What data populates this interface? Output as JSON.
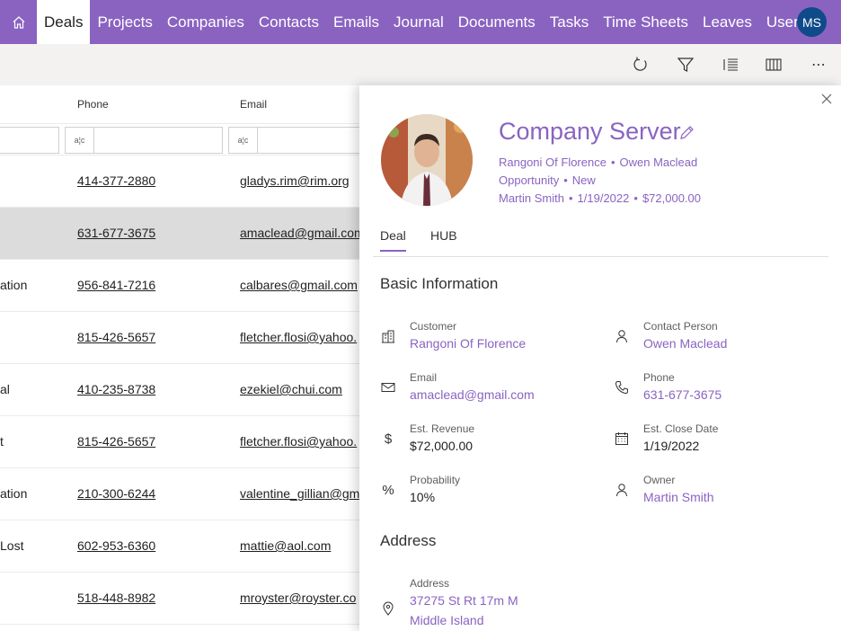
{
  "nav": {
    "items": [
      "Deals",
      "Projects",
      "Companies",
      "Contacts",
      "Emails",
      "Journal",
      "Documents",
      "Tasks",
      "Time Sheets",
      "Leaves",
      "Users"
    ],
    "active": "Deals",
    "user_initials": "MS"
  },
  "toolbar": {
    "icons": [
      "refresh-icon",
      "filter-icon",
      "list-view-icon",
      "columns-icon",
      "more-icon"
    ],
    "more_label": "⋯"
  },
  "grid": {
    "headers": {
      "phone": "Phone",
      "email": "Email"
    },
    "filter_icon_text": "a¦c",
    "rows": [
      {
        "stage": "",
        "phone": "414-377-2880",
        "email": "gladys.rim@rim.org"
      },
      {
        "stage": "",
        "phone": "631-677-3675",
        "email": "amaclead@gmail.com",
        "selected": true
      },
      {
        "stage": "ation",
        "phone": "956-841-7216",
        "email": "calbares@gmail.com"
      },
      {
        "stage": "",
        "phone": "815-426-5657",
        "email": "fletcher.flosi@yahoo."
      },
      {
        "stage": "al",
        "phone": "410-235-8738",
        "email": "ezekiel@chui.com"
      },
      {
        "stage": "t",
        "phone": "815-426-5657",
        "email": "fletcher.flosi@yahoo."
      },
      {
        "stage": "ation",
        "phone": "210-300-6244",
        "email": "valentine_gillian@gm"
      },
      {
        "stage": "Lost",
        "phone": "602-953-6360",
        "email": "mattie@aol.com"
      },
      {
        "stage": "",
        "phone": "518-448-8982",
        "email": "mroyster@royster.co"
      }
    ]
  },
  "panel": {
    "title": "Company Server",
    "meta_line1": {
      "company": "Rangoni Of Florence",
      "contact": "Owen Maclead"
    },
    "meta_line2": {
      "type": "Opportunity",
      "stage": "New"
    },
    "meta_line3": {
      "owner": "Martin Smith",
      "date": "1/19/2022",
      "amount": "$72,000.00"
    },
    "dot": "•",
    "tabs": [
      "Deal",
      "HUB"
    ],
    "basic_title": "Basic Information",
    "fields": {
      "customer": {
        "label": "Customer",
        "value": "Rangoni Of Florence"
      },
      "contact_person": {
        "label": "Contact Person",
        "value": "Owen Maclead"
      },
      "email": {
        "label": "Email",
        "value": "amaclead@gmail.com"
      },
      "phone": {
        "label": "Phone",
        "value": "631-677-3675"
      },
      "revenue": {
        "label": "Est. Revenue",
        "value": "$72,000.00"
      },
      "close_date": {
        "label": "Est. Close Date",
        "value": "1/19/2022"
      },
      "probability": {
        "label": "Probability",
        "value": "10%"
      },
      "owner": {
        "label": "Owner",
        "value": "Martin Smith"
      }
    },
    "address_title": "Address",
    "address": {
      "label": "Address",
      "line1": "37275 St  Rt 17m M",
      "line2": "Middle Island"
    },
    "revenue_icon_text": "$",
    "probability_icon_text": "%"
  },
  "colors": {
    "accent": "#8a63c1",
    "avatar": "#0f4a8a",
    "selected_row": "#dcdcdc"
  }
}
